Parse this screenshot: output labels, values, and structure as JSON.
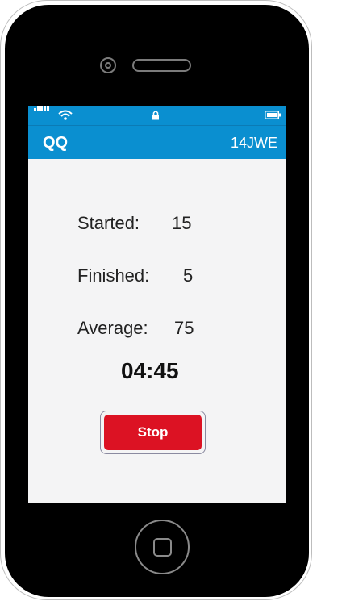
{
  "header": {
    "title": "QQ",
    "code": "14JWE"
  },
  "stats": [
    {
      "label": "Started:",
      "value": "15"
    },
    {
      "label": "Finished:",
      "value": "5"
    },
    {
      "label": "Average:",
      "value": "75"
    }
  ],
  "timer": "04:45",
  "actions": {
    "stop_label": "Stop"
  },
  "colors": {
    "accent": "#0a8fd0",
    "stop": "#dc1223",
    "screen_bg": "#f4f4f5"
  },
  "status_icons": [
    "signal-icon",
    "wifi-icon",
    "lock-icon",
    "battery-icon"
  ]
}
